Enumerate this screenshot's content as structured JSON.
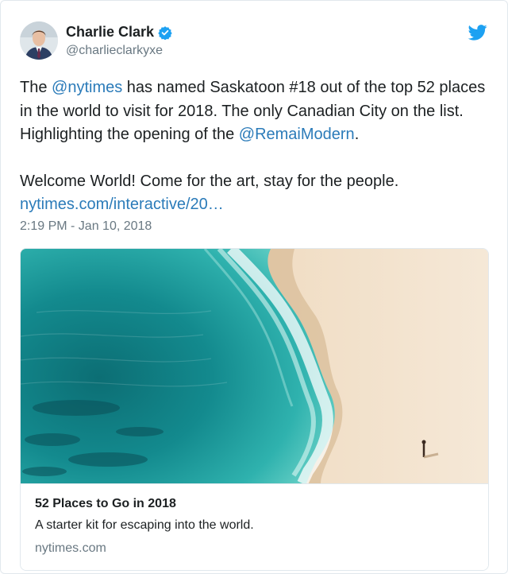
{
  "tweet": {
    "author": {
      "display_name": "Charlie Clark",
      "handle": "@charlieclarkyxe",
      "verified_icon": "verified-badge-icon",
      "avatar_icon": "avatar-portrait"
    },
    "brand_icon": "twitter-bird-icon",
    "brand_color": "#1da1f2",
    "link_color": "#2b7bb9",
    "text": {
      "p1_t1": "The ",
      "mention_nytimes": "@nytimes",
      "p1_t2": " has named Saskatoon #18 out of the top 52 places in the world to visit for 2018. The only Canadian City on the list.  Highlighting the opening of the ",
      "mention_remai": "@RemaiModern",
      "p1_t3": ".",
      "p2_t1": "Welcome World!  Come for the art, stay for the people.",
      "url": "nytimes.com/interactive/20…"
    },
    "timestamp": "2:19 PM - Jan 10, 2018",
    "link_card": {
      "title": "52 Places to Go in 2018",
      "description": "A starter kit for escaping into the world.",
      "domain": "nytimes.com"
    }
  }
}
